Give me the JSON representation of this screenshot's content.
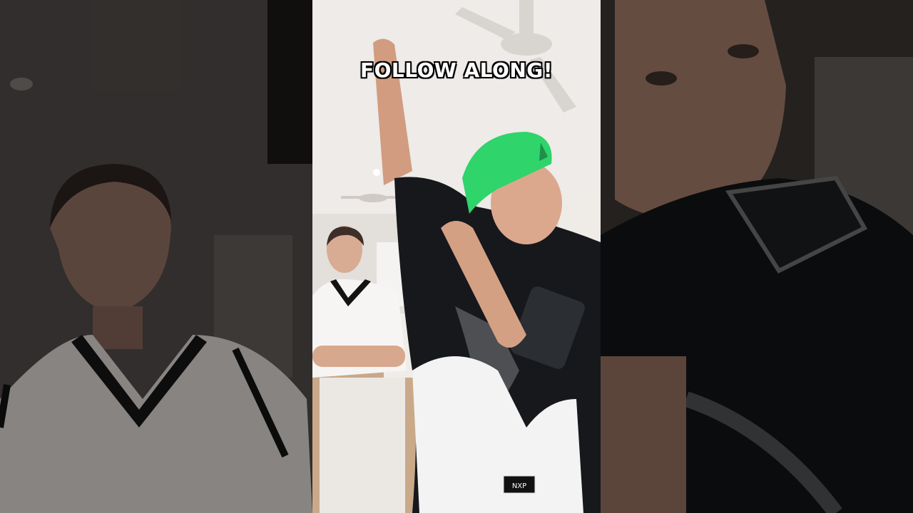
{
  "video": {
    "caption": "FOLLOW ALONG!",
    "jersey_tag": "NXP"
  },
  "colors": {
    "cap": "#2fd46a",
    "jersey_dark": "#16181c",
    "jersey_light": "#f3f3f3",
    "room": "#ece8e4"
  }
}
